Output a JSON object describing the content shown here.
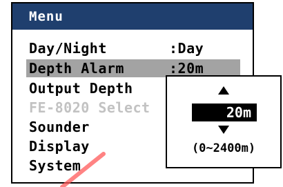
{
  "menu": {
    "title": "Menu",
    "items": [
      {
        "label": "Day/Night",
        "value": ":Day"
      },
      {
        "label": "Depth Alarm",
        "value": ":20m"
      },
      {
        "label": "Output Depth",
        "value": ""
      },
      {
        "label": "FE-8020 Select",
        "value": ""
      },
      {
        "label": "Sounder",
        "value": ""
      },
      {
        "label": "Display",
        "value": ""
      },
      {
        "label": "System",
        "value": ""
      }
    ]
  },
  "popup": {
    "value": "20m",
    "range": "(0~2400m)"
  },
  "colors": {
    "title_bar": "#1f3f6e",
    "selected_row": "#a3a3a3",
    "disabled_text": "#c2c2c2",
    "watermark": "#ff5a5a"
  }
}
